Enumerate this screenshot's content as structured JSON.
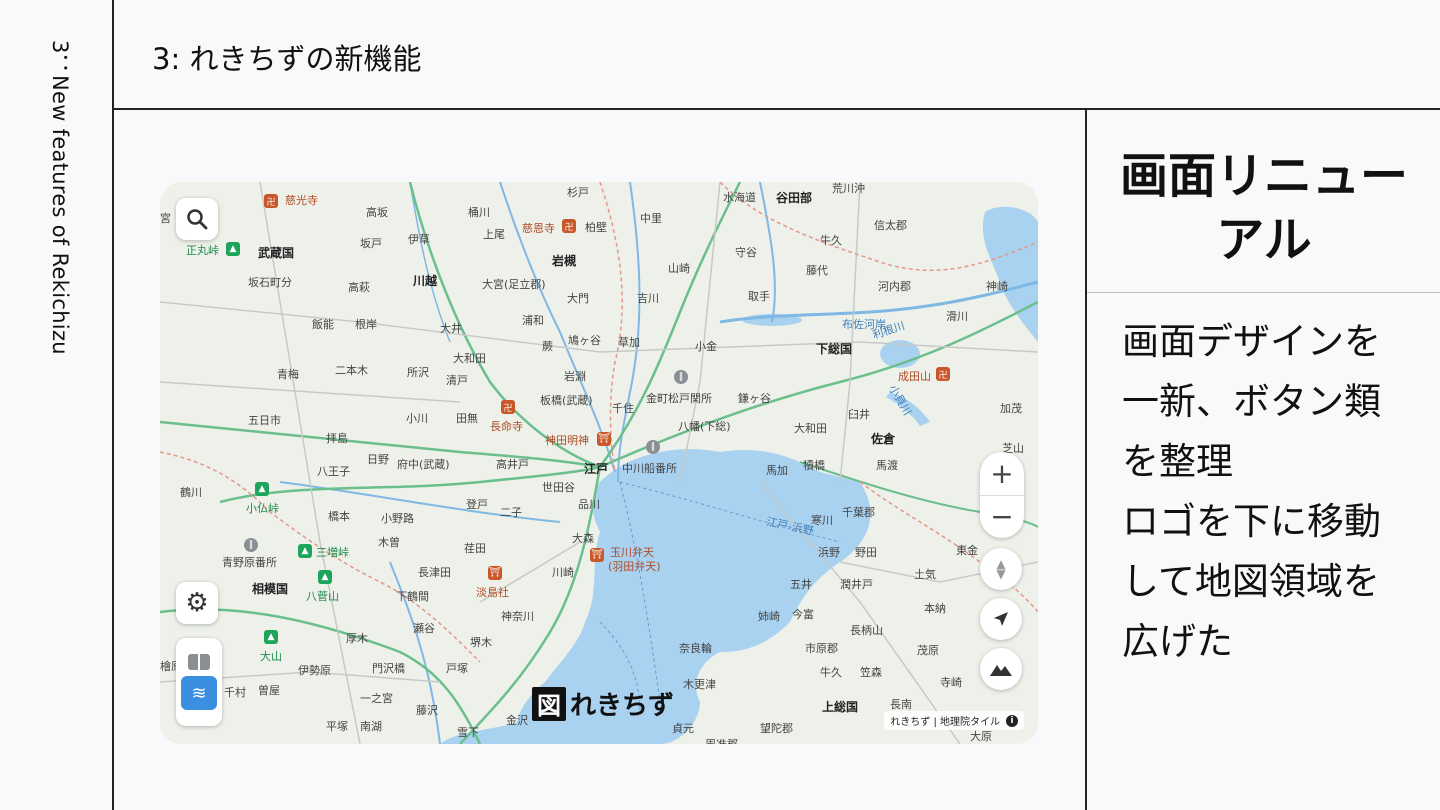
{
  "sidebar": {
    "vertical_label": "3：New features of Rekichizu"
  },
  "header": {
    "title": "3: れきちずの新機能"
  },
  "card": {
    "title_line1": "画面リニュー",
    "title_line2": "アル",
    "body_lines": [
      "画面デザインを",
      "一新、ボタン類",
      "を整理",
      "ロゴを下に移動",
      "して地図領域を",
      "広げた"
    ]
  },
  "map": {
    "logo_mark": "図",
    "logo_text": "れきちず",
    "attribution": "れきちず | 地理院タイル",
    "info_icon": "info-icon",
    "colors": {
      "water": "#a9d2f1",
      "land": "#eef1ea",
      "river": "#7fb8e3",
      "road_main": "#6bbf8c",
      "road": "#c7c9c8",
      "shrine": "#c8572a",
      "mountain": "#1fa55b"
    },
    "labels": {
      "l0": "慈光寺",
      "l1": "正丸峠",
      "l2": "武蔵国",
      "l3": "坂石町分",
      "l4": "高坂",
      "l5": "坂戸",
      "l6": "伊草",
      "l7": "桶川",
      "l8": "上尾",
      "l9": "慈恩寺",
      "l10": "柏壁",
      "l11": "岩槻",
      "l12": "杉戸",
      "l13": "中里",
      "l14": "水海道",
      "l15": "谷田部",
      "l16": "荒川沖",
      "l17": "信太郡",
      "l18": "牛久",
      "l19": "藤代",
      "l20": "守谷",
      "l21": "山崎",
      "l22": "吉川",
      "l23": "大門",
      "l24": "大宮(足立郡)",
      "l25": "川越",
      "l26": "高萩",
      "l27": "大井",
      "l28": "浦和",
      "l29": "鳩ヶ谷",
      "l30": "草加",
      "l31": "取手",
      "l32": "河内郡",
      "l33": "神崎",
      "l34": "布佐河岸",
      "l35": "滑川",
      "l36": "下総国",
      "l37": "小金",
      "l38": "飯能",
      "l39": "根岸",
      "l40": "大和田",
      "l41": "蕨",
      "l42": "二本木",
      "l43": "所沢",
      "l44": "清戸",
      "l45": "岩淵",
      "l46": "青梅",
      "l47": "金町松戸関所",
      "l48": "鎌ヶ谷",
      "l49": "成田山",
      "l50": "五日市",
      "l51": "小川",
      "l52": "田無",
      "l53": "長命寺",
      "l54": "板橋(武蔵)",
      "l55": "千住",
      "l56": "臼井",
      "l57": "加茂",
      "l58": "拝島",
      "l59": "神田明神",
      "l60": "八幡(下総)",
      "l61": "大和田",
      "l62": "佐倉",
      "l63": "芝山",
      "l64": "八王子",
      "l65": "日野",
      "l66": "府中(武蔵)",
      "l67": "高井戸",
      "l68": "江戸",
      "l69": "中川船番所",
      "l70": "馬加",
      "l71": "犢橋",
      "l72": "馬渡",
      "l73": "世田谷",
      "l74": "鶴川",
      "l75": "小仏峠",
      "l76": "橋本",
      "l77": "小野路",
      "l78": "登戸",
      "l79": "二子",
      "l80": "品川",
      "l81": "寒川",
      "l82": "千葉郡",
      "l83": "青野原番所",
      "l84": "三増峠",
      "l85": "木曽",
      "l86": "荏田",
      "l87": "大森",
      "l88": "玉川弁天",
      "l89": "(羽田弁天)",
      "l90": "浜野",
      "l91": "野田",
      "l92": "東金",
      "l93": "相模国",
      "l94": "八菅山",
      "l95": "長津田",
      "l96": "淡島社",
      "l97": "川崎",
      "l98": "五井",
      "l99": "潤井戸",
      "l100": "土気",
      "l101": "下鶴間",
      "l102": "瀬谷",
      "l103": "神奈川",
      "l104": "姉崎",
      "l105": "今富",
      "l106": "長柄山",
      "l107": "本納",
      "l108": "大山",
      "l109": "厚木",
      "l110": "堺木",
      "l111": "奈良輪",
      "l112": "市原郡",
      "l113": "茂原",
      "l114": "伊勢原",
      "l115": "門沢橋",
      "l116": "戸塚",
      "l117": "牛久",
      "l118": "笠森",
      "l119": "千村",
      "l120": "曽屋",
      "l121": "一之宮",
      "l122": "藤沢",
      "l123": "木更津",
      "l124": "上総国",
      "l125": "寺崎",
      "l126": "平塚",
      "l127": "南湖",
      "l128": "雪下",
      "l129": "金沢",
      "l130": "貞元",
      "l131": "望陀郡",
      "l132": "長南",
      "l133": "周准郡",
      "l134": "大原",
      "l135": "宮",
      "l136": "檜原",
      "l137": "江戸-浜野",
      "l138": "利根川",
      "l139": "小貝川"
    }
  }
}
